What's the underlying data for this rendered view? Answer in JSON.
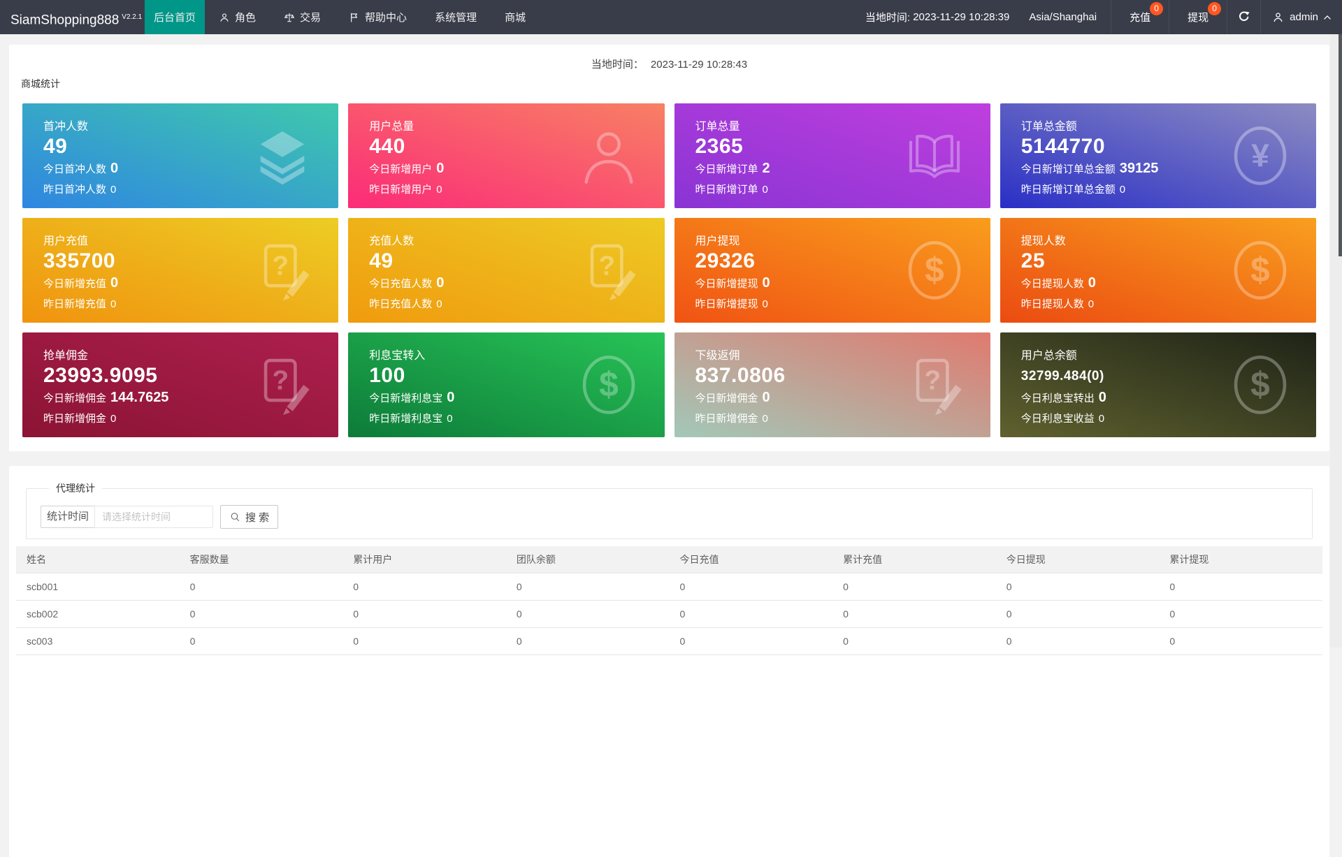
{
  "navbar": {
    "logo": "SiamShopping888",
    "version": "V2.2.1",
    "menu": [
      {
        "label": "后台首页",
        "icon": "",
        "active": true
      },
      {
        "label": "角色",
        "icon": "user",
        "active": false
      },
      {
        "label": "交易",
        "icon": "scale",
        "active": false
      },
      {
        "label": "帮助中心",
        "icon": "flag",
        "active": false
      },
      {
        "label": "系统管理",
        "icon": "",
        "active": false
      },
      {
        "label": "商城",
        "icon": "",
        "active": false
      }
    ],
    "local_time_label": "当地时间:",
    "local_time": "2023-11-29 10:28:39",
    "timezone": "Asia/Shanghai",
    "recharge_label": "充值",
    "recharge_badge": "0",
    "withdraw_label": "提现",
    "withdraw_badge": "0",
    "username": "admin"
  },
  "overview": {
    "local_time_label": "当地时间：",
    "local_time": "2023-11-29 10:28:43",
    "section_title": "商城统计",
    "cards": [
      {
        "title": "首冲人数",
        "value": "49",
        "small": false,
        "line1_label": "今日首冲人数",
        "line1_value": "0",
        "line2_label": "昨日首冲人数",
        "line2_value": "0",
        "icon": "layers",
        "g0": "#2f86e1",
        "g1": "#3fc8ad"
      },
      {
        "title": "用户总量",
        "value": "440",
        "small": false,
        "line1_label": "今日新增用户",
        "line1_value": "0",
        "line2_label": "昨日新增用户",
        "line2_value": "0",
        "icon": "person",
        "g0": "#fb2b78",
        "g1": "#f88064"
      },
      {
        "title": "订单总量",
        "value": "2365",
        "small": false,
        "line1_label": "今日新增订单",
        "line1_value": "2",
        "line2_label": "昨日新增订单",
        "line2_value": "0",
        "icon": "book",
        "g0": "#8a34d4",
        "g1": "#bf3fde"
      },
      {
        "title": "订单总金额",
        "value": "5144770",
        "small": false,
        "line1_label": "今日新增订单总金额",
        "line1_value": "39125",
        "line2_label": "昨日新增订单总金额",
        "line2_value": "0",
        "icon": "yen",
        "g0": "#2a2fc6",
        "g1": "#8d8cc2"
      },
      {
        "title": "用户充值",
        "value": "335700",
        "small": false,
        "line1_label": "今日新增充值",
        "line1_value": "0",
        "line2_label": "昨日新增充值",
        "line2_value": "0",
        "icon": "docq",
        "g0": "#f0930f",
        "g1": "#edcd24"
      },
      {
        "title": "充值人数",
        "value": "49",
        "small": false,
        "line1_label": "今日充值人数",
        "line1_value": "0",
        "line2_label": "昨日充值人数",
        "line2_value": "0",
        "icon": "docq",
        "g0": "#f09b0e",
        "g1": "#edca24"
      },
      {
        "title": "用户提现",
        "value": "29326",
        "small": false,
        "line1_label": "今日新增提现",
        "line1_value": "0",
        "line2_label": "昨日新增提现",
        "line2_value": "0",
        "icon": "dollar",
        "g0": "#f05313",
        "g1": "#f99d1d"
      },
      {
        "title": "提现人数",
        "value": "25",
        "small": false,
        "line1_label": "今日提现人数",
        "line1_value": "0",
        "line2_label": "昨日提现人数",
        "line2_value": "0",
        "icon": "dollar",
        "g0": "#eb4b11",
        "g1": "#f99f1e"
      },
      {
        "title": "抢单佣金",
        "value": "23993.9095",
        "small": false,
        "line1_label": "今日新增佣金",
        "line1_value": "144.7625",
        "line2_label": "昨日新增佣金",
        "line2_value": "0",
        "icon": "docq",
        "g0": "#8b1434",
        "g1": "#ad1f4e"
      },
      {
        "title": "利息宝转入",
        "value": "100",
        "small": false,
        "line1_label": "今日新增利息宝",
        "line1_value": "0",
        "line2_label": "昨日新增利息宝",
        "line2_value": "0",
        "icon": "dollar",
        "g0": "#0d7b39",
        "g1": "#28c457"
      },
      {
        "title": "下级返佣",
        "value": "837.0806",
        "small": false,
        "line1_label": "今日新增佣金",
        "line1_value": "0",
        "line2_label": "昨日新增佣金",
        "line2_value": "0",
        "icon": "docq",
        "g0": "#a2c8b8",
        "g1": "#e07a6f"
      },
      {
        "title": "用户总余额",
        "value": "32799.484(0)",
        "small": true,
        "line1_label": "今日利息宝转出",
        "line1_value": "0",
        "line2_label": "今日利息宝收益",
        "line2_value": "0",
        "icon": "dollar",
        "g0": "#5f612e",
        "g1": "#1e2317"
      }
    ]
  },
  "agent": {
    "section_title": "代理统计",
    "filter_label": "统计时间",
    "filter_placeholder": "请选择统计时间",
    "search_label": "搜 索",
    "table": {
      "headers": [
        "姓名",
        "客服数量",
        "累计用户",
        "团队余额",
        "今日充值",
        "累计充值",
        "今日提现",
        "累计提现"
      ],
      "rows": [
        [
          "scb001",
          "0",
          "0",
          "0",
          "0",
          "0",
          "0",
          "0"
        ],
        [
          "scb002",
          "0",
          "0",
          "0",
          "0",
          "0",
          "0",
          "0"
        ],
        [
          "sc003",
          "0",
          "0",
          "0",
          "0",
          "0",
          "0",
          "0"
        ]
      ]
    }
  }
}
